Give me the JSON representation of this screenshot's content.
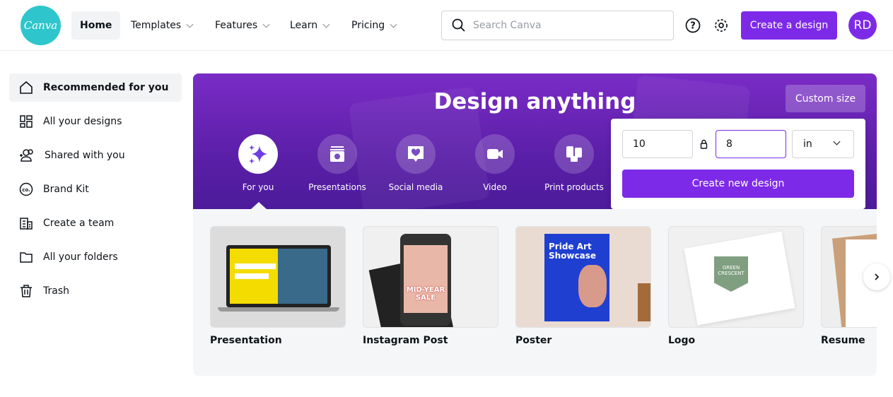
{
  "header": {
    "logo": "Canva",
    "nav": [
      {
        "label": "Home"
      },
      {
        "label": "Templates"
      },
      {
        "label": "Features"
      },
      {
        "label": "Learn"
      },
      {
        "label": "Pricing"
      }
    ],
    "search_placeholder": "Search Canva",
    "create_label": "Create a design",
    "avatar_initials": "RD"
  },
  "sidebar": {
    "items": [
      {
        "label": "Recommended for you",
        "icon": "home-icon"
      },
      {
        "label": "All your designs",
        "icon": "grid-icon"
      },
      {
        "label": "Shared with you",
        "icon": "users-icon"
      },
      {
        "label": "Brand Kit",
        "icon": "brand-kit-icon"
      },
      {
        "label": "Create a team",
        "icon": "building-icon"
      },
      {
        "label": "All your folders",
        "icon": "folder-icon"
      },
      {
        "label": "Trash",
        "icon": "trash-icon"
      }
    ]
  },
  "banner": {
    "title": "Design anything",
    "custom_size": "Custom size",
    "categories": [
      {
        "label": "For you",
        "icon": "sparkle-icon"
      },
      {
        "label": "Presentations",
        "icon": "presentation-icon"
      },
      {
        "label": "Social media",
        "icon": "heart-bubble-icon"
      },
      {
        "label": "Video",
        "icon": "video-camera-icon"
      },
      {
        "label": "Print products",
        "icon": "print-products-icon"
      }
    ]
  },
  "custom_popup": {
    "width": "10",
    "height": "8",
    "unit": "in",
    "create_label": "Create new design"
  },
  "designs": [
    {
      "label": "Presentation"
    },
    {
      "label": "Instagram Post"
    },
    {
      "label": "Poster"
    },
    {
      "label": "Logo"
    },
    {
      "label": "Resume"
    }
  ],
  "thumb_text": {
    "ig": "MID-YEAR SALE",
    "poster": "Pride Art Showcase",
    "logo": "GREEN CRESCENT"
  },
  "colors": {
    "accent": "#7d2ae8",
    "logo": "#2ec6cc"
  }
}
